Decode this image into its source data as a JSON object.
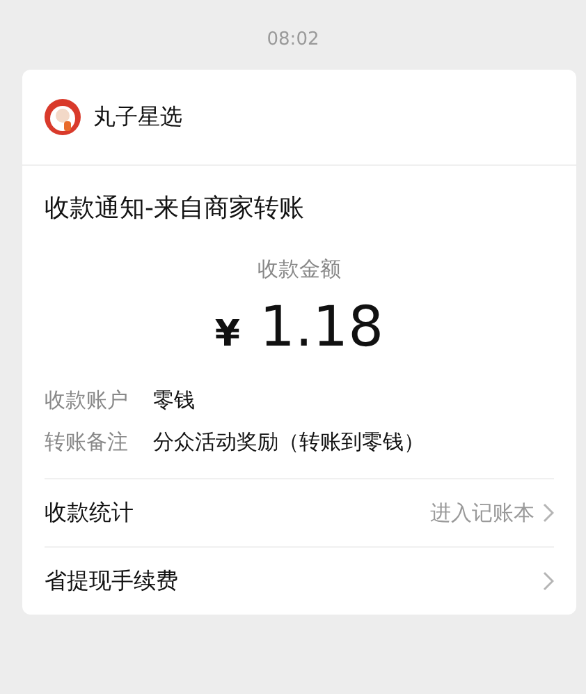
{
  "time": "08:02",
  "merchant": {
    "name": "丸子星选"
  },
  "title": "收款通知-来自商家转账",
  "amount": {
    "label": "收款金额",
    "currency": "¥",
    "value": "1.18"
  },
  "details": [
    {
      "label": "收款账户",
      "value": "零钱"
    },
    {
      "label": "转账备注",
      "value": "分众活动奖励（转账到零钱）"
    }
  ],
  "links": [
    {
      "label": "收款统计",
      "hint": "进入记账本"
    },
    {
      "label": "省提现手续费"
    }
  ]
}
